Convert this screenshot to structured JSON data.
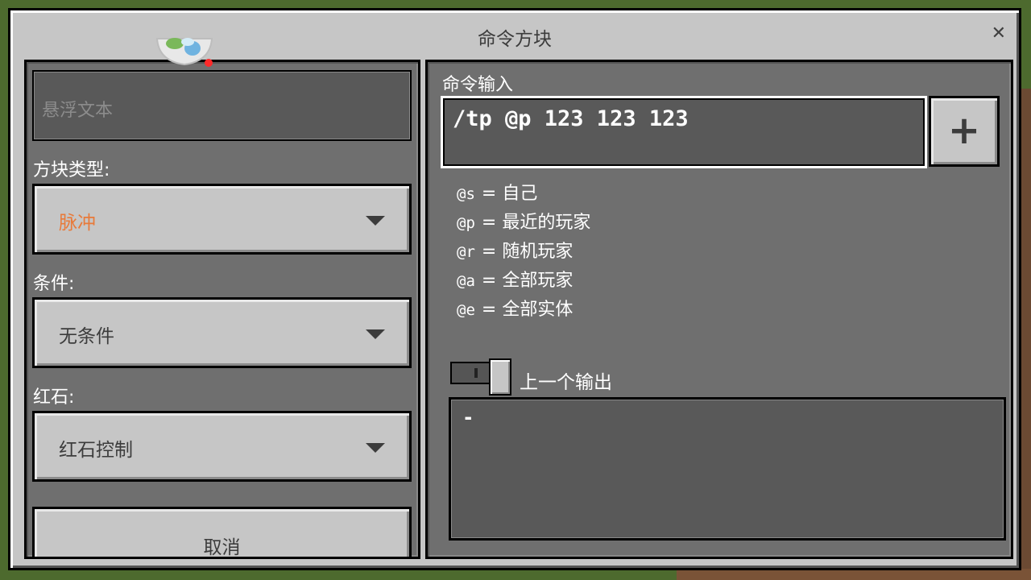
{
  "dialog": {
    "title": "命令方块",
    "close_symbol": "✕"
  },
  "left": {
    "hover_text_placeholder": "悬浮文本",
    "block_type": {
      "label": "方块类型:",
      "value": "脉冲"
    },
    "condition": {
      "label": "条件:",
      "value": "无条件"
    },
    "redstone": {
      "label": "红石:",
      "value": "红石控制"
    },
    "cancel_label": "取消"
  },
  "right": {
    "command_label": "命令输入",
    "command_value": "/tp @p 123 123 123",
    "plus_symbol": "+",
    "selectors": [
      {
        "key": "@s",
        "desc": "= 自己"
      },
      {
        "key": "@p",
        "desc": "= 最近的玩家"
      },
      {
        "key": "@r",
        "desc": "= 随机玩家"
      },
      {
        "key": "@a",
        "desc": "= 全部玩家"
      },
      {
        "key": "@e",
        "desc": "= 全部实体"
      }
    ],
    "previous_output_label": "上一个输出",
    "output_text": "-"
  },
  "colors": {
    "accent_orange": "#e87a3a",
    "panel": "#6f6f6f",
    "button": "#c6c6c6"
  },
  "icons": {
    "close": "close-icon",
    "add": "plus-icon",
    "dropdown": "chevron-down-icon",
    "bowl": "bowl-icon"
  }
}
